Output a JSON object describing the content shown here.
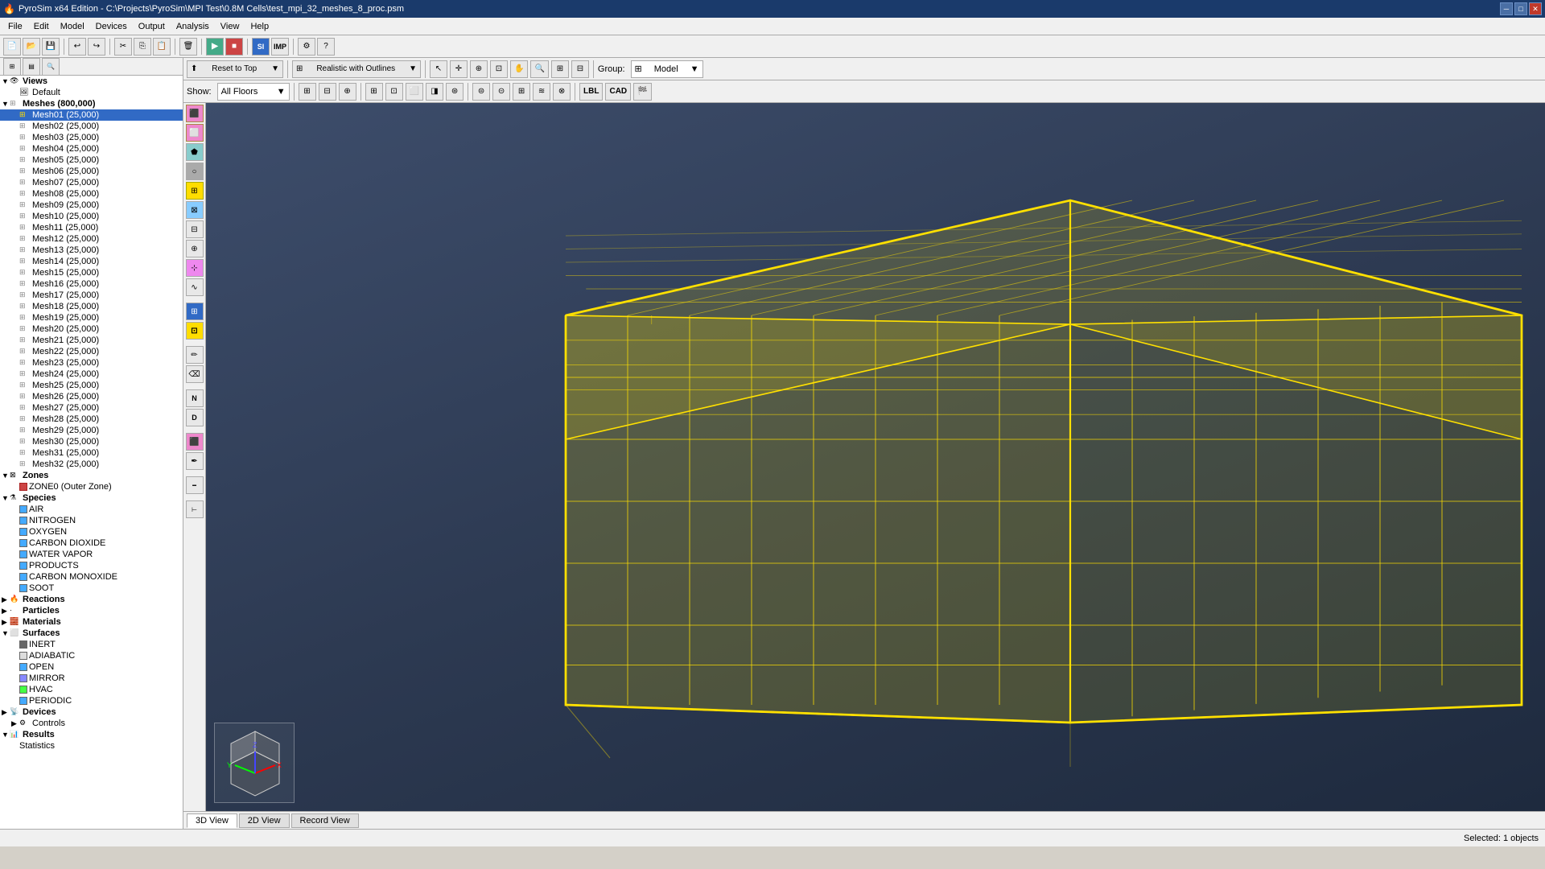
{
  "titleBar": {
    "title": "PyroSim x64 Edition - C:\\Projects\\PyroSim\\MPI Test\\0.8M Cells\\test_mpi_32_meshes_8_proc.psm",
    "minBtn": "─",
    "maxBtn": "□",
    "closeBtn": "✕"
  },
  "menuBar": {
    "items": [
      "File",
      "Edit",
      "Model",
      "Devices",
      "Output",
      "Analysis",
      "View",
      "Help"
    ]
  },
  "viewportToolbar1": {
    "resetToTop": "Reset to Top",
    "resetDropdown": "▼",
    "viewMode": "Realistic with Outlines",
    "viewDropdown": "▼",
    "groupLabel": "Group:",
    "groupValue": "Model",
    "groupDropdown": "▼"
  },
  "viewportToolbar2": {
    "showLabel": "Show:",
    "showValue": "All Floors",
    "showDropdown": "▼",
    "lblLabel": "LBL",
    "cadLabel": "CAD"
  },
  "leftPanel": {
    "views": "Views",
    "default": "Default",
    "meshes": "Meshes (800,000)",
    "meshItems": [
      "Mesh01 (25,000)",
      "Mesh02 (25,000)",
      "Mesh03 (25,000)",
      "Mesh04 (25,000)",
      "Mesh05 (25,000)",
      "Mesh06 (25,000)",
      "Mesh07 (25,000)",
      "Mesh08 (25,000)",
      "Mesh09 (25,000)",
      "Mesh10 (25,000)",
      "Mesh11 (25,000)",
      "Mesh12 (25,000)",
      "Mesh13 (25,000)",
      "Mesh14 (25,000)",
      "Mesh15 (25,000)",
      "Mesh16 (25,000)",
      "Mesh17 (25,000)",
      "Mesh18 (25,000)",
      "Mesh19 (25,000)",
      "Mesh20 (25,000)",
      "Mesh21 (25,000)",
      "Mesh22 (25,000)",
      "Mesh23 (25,000)",
      "Mesh24 (25,000)",
      "Mesh25 (25,000)",
      "Mesh26 (25,000)",
      "Mesh27 (25,000)",
      "Mesh28 (25,000)",
      "Mesh29 (25,000)",
      "Mesh30 (25,000)",
      "Mesh31 (25,000)",
      "Mesh32 (25,000)"
    ],
    "zones": "Zones",
    "zone0": "ZONE0 (Outer Zone)",
    "species": "Species",
    "speciesItems": [
      "AIR",
      "NITROGEN",
      "OXYGEN",
      "CARBON DIOXIDE",
      "WATER VAPOR",
      "PRODUCTS",
      "CARBON MONOXIDE",
      "SOOT"
    ],
    "reactions": "Reactions",
    "particles": "Particles",
    "materials": "Materials",
    "surfaces": "Surfaces",
    "surfaceItems": [
      {
        "name": "INERT",
        "color": "#888"
      },
      {
        "name": "ADIABATIC",
        "color": "#ddd"
      },
      {
        "name": "OPEN",
        "color": "#4af"
      },
      {
        "name": "MIRROR",
        "color": "#88f"
      },
      {
        "name": "HVAC",
        "color": "#4f4"
      },
      {
        "name": "PERIODIC",
        "color": "#4af"
      }
    ],
    "devices": "Devices",
    "controls": "Controls",
    "results": "Results"
  },
  "statusBar": {
    "selected": "Selected: 1 objects"
  },
  "bottomTabs": {
    "tab3d": "3D View",
    "tab2d": "2D View",
    "tabRecord": "Record View"
  },
  "icons": {
    "arrow": "↖",
    "move": "✛",
    "select": "⊹",
    "zoom": "🔍",
    "pan": "✋",
    "rotate": "↻",
    "grid": "⊞",
    "snap": "⊡"
  }
}
